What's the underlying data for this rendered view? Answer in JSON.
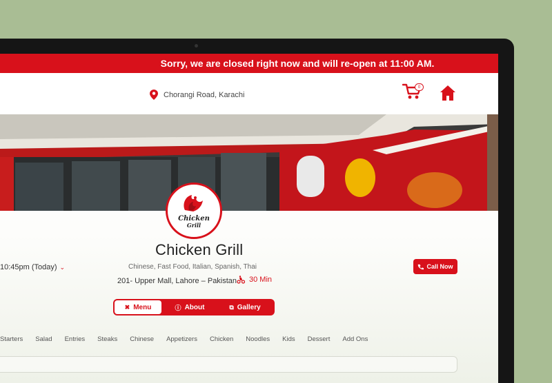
{
  "banner": {
    "message": "Sorry, we are closed right now and will re-open at 11:00 AM."
  },
  "header": {
    "location": "Chorangi Road, Karachi",
    "cart_count": "0",
    "icons": {
      "location": "location-pin-icon",
      "cart": "cart-icon",
      "home": "home-icon"
    }
  },
  "restaurant": {
    "logo_text": "Chicken Grill",
    "name": "Chicken Grill",
    "cuisines": "Chinese, Fast Food, Italian, Spanish, Thai",
    "address": "201- Upper Mall, Lahore – Pakistan",
    "delivery_time": "30 Min",
    "hours": "10:45pm (Today)",
    "call_label": "Call Now"
  },
  "tabs": [
    {
      "label": "Menu",
      "icon": "cutlery-icon",
      "active": true
    },
    {
      "label": "About",
      "icon": "info-icon",
      "active": false
    },
    {
      "label": "Gallery",
      "icon": "gallery-icon",
      "active": false
    }
  ],
  "categories": [
    "Starters",
    "Salad",
    "Entries",
    "Steaks",
    "Chinese",
    "Appetizers",
    "Chicken",
    "Noodles",
    "Kids",
    "Dessert",
    "Add Ons"
  ],
  "colors": {
    "brand_red": "#d8111b",
    "background": "#a9bd94",
    "device": "#151515"
  }
}
